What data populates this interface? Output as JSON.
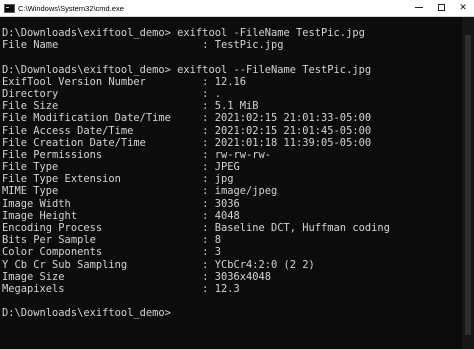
{
  "window": {
    "title": "C:\\Windows\\System32\\cmd.exe"
  },
  "console": {
    "lines": [
      "D:\\Downloads\\exiftool_demo> exiftool -FileName TestPic.jpg",
      "File Name                       : TestPic.jpg",
      "",
      "D:\\Downloads\\exiftool_demo> exiftool --FileName TestPic.jpg",
      "ExifTool Version Number         : 12.16",
      "Directory                       : .",
      "File Size                       : 5.1 MiB",
      "File Modification Date/Time     : 2021:02:15 21:01:33-05:00",
      "File Access Date/Time           : 2021:02:15 21:01:45-05:00",
      "File Creation Date/Time         : 2021:01:18 11:39:05-05:00",
      "File Permissions                : rw-rw-rw-",
      "File Type                       : JPEG",
      "File Type Extension             : jpg",
      "MIME Type                       : image/jpeg",
      "Image Width                     : 3036",
      "Image Height                    : 4048",
      "Encoding Process                : Baseline DCT, Huffman coding",
      "Bits Per Sample                 : 8",
      "Color Components                : 3",
      "Y Cb Cr Sub Sampling            : YCbCr4:2:0 (2 2)",
      "Image Size                      : 3036x4048",
      "Megapixels                      : 12.3",
      "",
      "D:\\Downloads\\exiftool_demo>"
    ]
  },
  "colors": {
    "background": "#0c0c0c",
    "text": "#d4d4d4"
  }
}
